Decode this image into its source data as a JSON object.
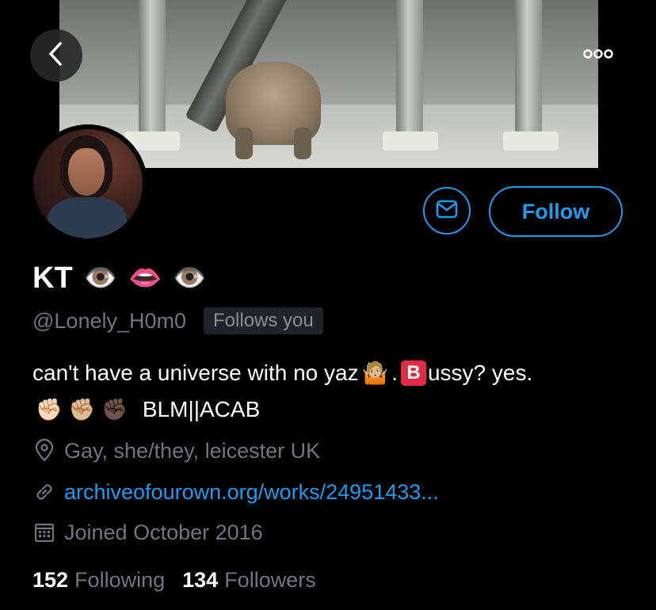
{
  "profile": {
    "display_name": "KT",
    "name_emojis": [
      "👁️",
      "👄",
      "👁️"
    ],
    "handle": "@Lonely_H0m0",
    "follows_you": "Follows you",
    "follow_label": "Follow",
    "bio": {
      "line1_a": "can't have a universe with no yaz",
      "line1_emoji": "🤷🏼",
      "line1_b": ".",
      "line1_box": "B",
      "line1_c": "ussy? yes.",
      "line2_fists": [
        "✊🏻",
        "✊🏼",
        "✊🏿"
      ],
      "line2_text": "BLM||ACAB"
    },
    "location": "Gay, she/they, leicester UK",
    "link": "archiveofourown.org/works/24951433...",
    "joined": "Joined October 2016",
    "following_count": "152",
    "following_label": "Following",
    "followers_count": "134",
    "followers_label": "Followers"
  },
  "icons": {
    "back": "chevron-left-icon",
    "more": "more-dots-icon",
    "message": "envelope-icon",
    "location": "location-pin-icon",
    "link": "link-icon",
    "calendar": "calendar-icon"
  },
  "colors": {
    "accent": "#1d9bf0",
    "muted_text": "#71767b",
    "background": "#000000"
  }
}
